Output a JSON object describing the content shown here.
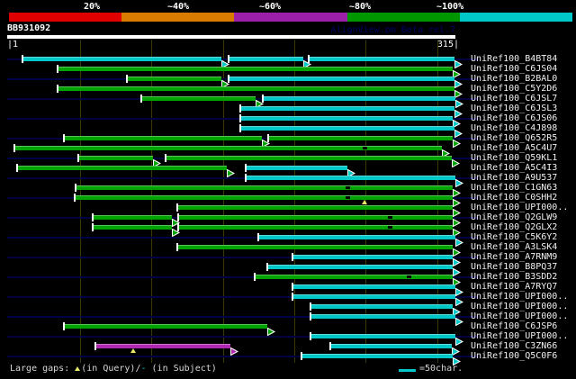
{
  "header": {
    "query_id": "BB931092",
    "watermark": "AlignView.pm Beta rel.7",
    "ruler_left": "|1",
    "ruler_right": "315|"
  },
  "legend": {
    "gaps_label": "Large gaps: ",
    "query_text": "(in Query)/",
    "subject_dash": "-",
    "subject_text": " (in Subject)",
    "unit_text": "=50char."
  },
  "colors": {
    "background": "#000000",
    "bar_green": "#00a400",
    "bar_cyan": "#00c8c8",
    "bar_purple": "#b028b0",
    "guide_navy": "#000042",
    "gridline_olive": "#3a3a00",
    "gap_yellow": "#e8e86a",
    "white": "#ffffff"
  },
  "chart_data": {
    "type": "bar",
    "subtype": "blast-hit-alignment-overview",
    "title": "BB931092",
    "xlim": [
      1,
      315
    ],
    "grid_interval": 50,
    "legend_position": "top",
    "identity_scale": [
      {
        "label": "20%",
        "color": "#e10000"
      },
      {
        "label": "~40%",
        "color": "#d97b00"
      },
      {
        "label": "~60%",
        "color": "#9b1fa8"
      },
      {
        "label": "~80%",
        "color": "#009600"
      },
      {
        "label": "~100%",
        "color": "#00c8c8"
      }
    ],
    "rows": [
      {
        "label": "UniRef100_B4BT84",
        "guide": true,
        "segments": [
          [
            12,
            151,
            "c"
          ],
          [
            156,
            208,
            "c"
          ],
          [
            212,
            314,
            "c"
          ]
        ]
      },
      {
        "label": "UniRef100_C6JS04",
        "guide": false,
        "segments": [
          [
            36,
            313,
            "g"
          ]
        ]
      },
      {
        "label": "UniRef100_B2BAL0",
        "guide": true,
        "segments": [
          [
            85,
            151,
            "g"
          ],
          [
            156,
            314,
            "c"
          ]
        ]
      },
      {
        "label": "UniRef100_C5Y2D6",
        "guide": false,
        "segments": [
          [
            36,
            314,
            "g"
          ]
        ]
      },
      {
        "label": "UniRef100_C6JSL7",
        "guide": true,
        "segments": [
          [
            95,
            175,
            "g"
          ],
          [
            180,
            315,
            "c"
          ]
        ]
      },
      {
        "label": "UniRef100_C6JSL3",
        "guide": false,
        "segments": [
          [
            164,
            314,
            "c"
          ]
        ]
      },
      {
        "label": "UniRef100_C6JS06",
        "guide": true,
        "segments": [
          [
            164,
            313,
            "c"
          ]
        ]
      },
      {
        "label": "UniRef100_C4J898",
        "guide": false,
        "segments": [
          [
            164,
            314,
            "c"
          ]
        ]
      },
      {
        "label": "UniRef100_Q652R5",
        "guide": true,
        "segments": [
          [
            41,
            179,
            "g"
          ],
          [
            184,
            313,
            "g"
          ]
        ]
      },
      {
        "label": "UniRef100_A5C4U7",
        "guide": false,
        "segments": [
          [
            6,
            305,
            "g"
          ]
        ],
        "subject_gaps": [
          251
        ]
      },
      {
        "label": "UniRef100_Q59KL1",
        "guide": true,
        "segments": [
          [
            51,
            103,
            "g"
          ],
          [
            112,
            312,
            "g"
          ]
        ]
      },
      {
        "label": "UniRef100_A5C4I3",
        "guide": false,
        "segments": [
          [
            8,
            155,
            "g"
          ],
          [
            168,
            239,
            "c"
          ]
        ]
      },
      {
        "label": "UniRef100_A9U537",
        "guide": true,
        "segments": [
          [
            168,
            315,
            "c"
          ]
        ]
      },
      {
        "label": "UniRef100_C1GN63",
        "guide": false,
        "segments": [
          [
            49,
            313,
            "g"
          ]
        ],
        "subject_gaps": [
          239
        ]
      },
      {
        "label": "UniRef100_C0SHH2",
        "guide": true,
        "segments": [
          [
            48,
            313,
            "g"
          ]
        ],
        "subject_gaps": [
          239
        ],
        "query_gaps": [
          251
        ]
      },
      {
        "label": "UniRef100_UPI000..",
        "guide": false,
        "segments": [
          [
            120,
            313,
            "g"
          ]
        ]
      },
      {
        "label": "UniRef100_Q2GLW9",
        "guide": true,
        "segments": [
          [
            61,
            116,
            "g"
          ],
          [
            121,
            313,
            "g"
          ]
        ],
        "subject_gaps": [
          269
        ]
      },
      {
        "label": "UniRef100_Q2GLX2",
        "guide": false,
        "segments": [
          [
            61,
            116,
            "g"
          ],
          [
            121,
            313,
            "g"
          ]
        ],
        "subject_gaps": [
          269
        ]
      },
      {
        "label": "UniRef100_C5K6Y2",
        "guide": true,
        "segments": [
          [
            177,
            315,
            "c"
          ]
        ]
      },
      {
        "label": "UniRef100_A3LSK4",
        "guide": false,
        "segments": [
          [
            120,
            313,
            "g"
          ]
        ]
      },
      {
        "label": "UniRef100_A7RNM9",
        "guide": true,
        "segments": [
          [
            201,
            313,
            "c"
          ]
        ]
      },
      {
        "label": "UniRef100_B8PQ37",
        "guide": false,
        "segments": [
          [
            183,
            313,
            "c"
          ]
        ]
      },
      {
        "label": "UniRef100_B3SDD2",
        "guide": true,
        "segments": [
          [
            174,
            313,
            "g"
          ]
        ],
        "subject_gaps": [
          282
        ]
      },
      {
        "label": "UniRef100_A7RYQ7",
        "guide": false,
        "segments": [
          [
            201,
            315,
            "c"
          ]
        ]
      },
      {
        "label": "UniRef100_UPI000..",
        "guide": true,
        "segments": [
          [
            201,
            315,
            "c"
          ]
        ]
      },
      {
        "label": "UniRef100_UPI000..",
        "guide": false,
        "segments": [
          [
            213,
            313,
            "c"
          ]
        ]
      },
      {
        "label": "UniRef100_UPI000..",
        "guide": true,
        "segments": [
          [
            213,
            315,
            "c"
          ]
        ]
      },
      {
        "label": "UniRef100_C6JSP6",
        "guide": false,
        "segments": [
          [
            41,
            183,
            "g"
          ]
        ]
      },
      {
        "label": "UniRef100_UPI000..",
        "guide": true,
        "segments": [
          [
            213,
            315,
            "c"
          ]
        ]
      },
      {
        "label": "UniRef100_C3ZN66",
        "guide": false,
        "segments": [
          [
            63,
            157,
            "p"
          ],
          [
            227,
            312,
            "c"
          ]
        ],
        "query_gaps": [
          89
        ]
      },
      {
        "label": "UniRef100_Q5C0F6",
        "guide": true,
        "segments": [
          [
            207,
            313,
            "c"
          ]
        ]
      }
    ]
  }
}
